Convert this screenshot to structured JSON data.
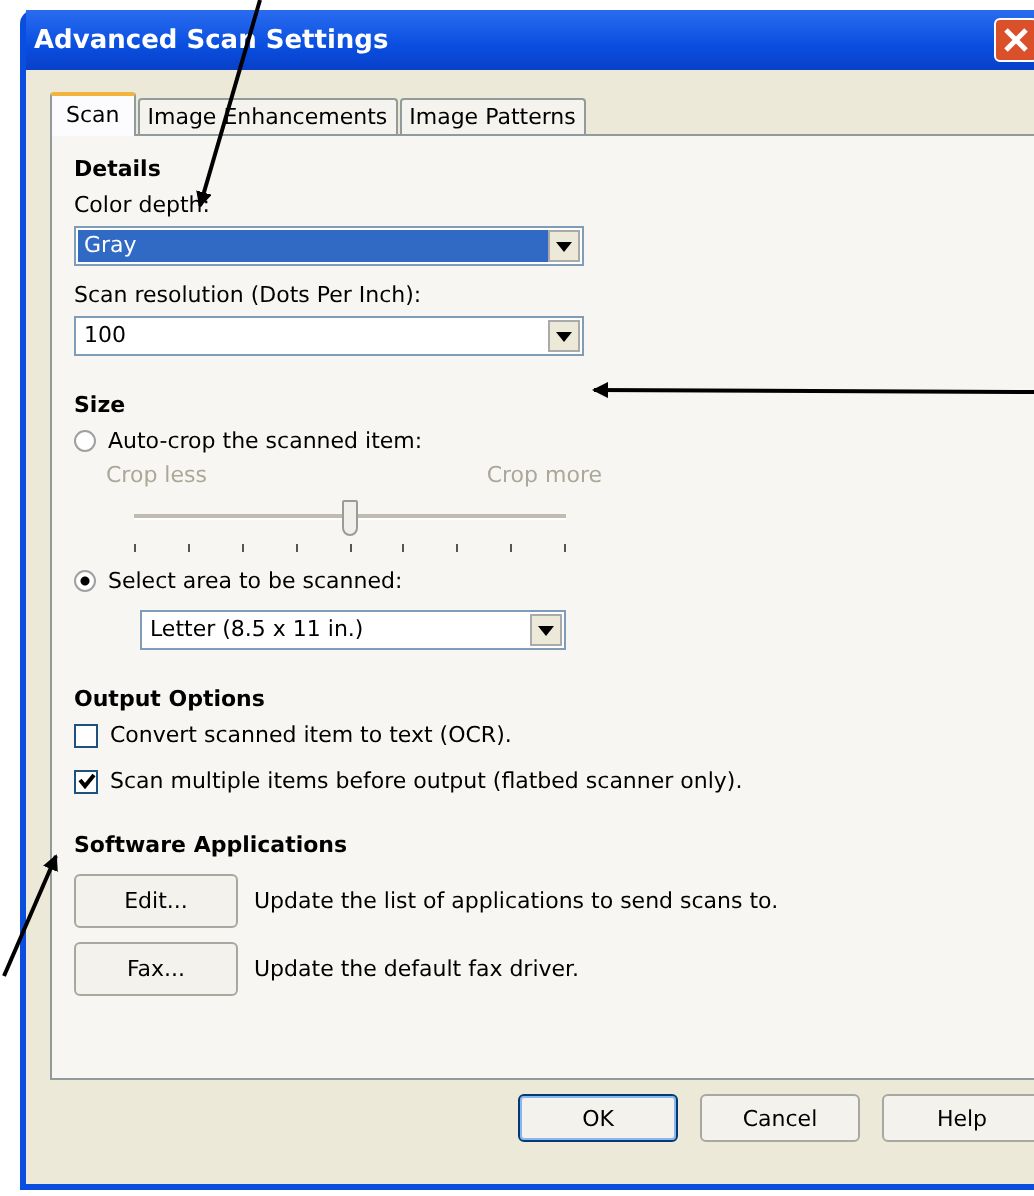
{
  "window": {
    "title": "Advanced Scan Settings"
  },
  "tabs": [
    {
      "label": "Scan",
      "selected": true
    },
    {
      "label": "Image Enhancements",
      "selected": false
    },
    {
      "label": "Image Patterns",
      "selected": false
    }
  ],
  "details": {
    "heading": "Details",
    "color_depth": {
      "label": "Color depth:",
      "value": "Gray",
      "focused": true
    },
    "resolution": {
      "label": "Scan resolution (Dots Per Inch):",
      "value": "100",
      "focused": false
    }
  },
  "size": {
    "heading": "Size",
    "auto_crop": {
      "label": "Auto-crop the scanned item:",
      "selected": false
    },
    "slider": {
      "min_label": "Crop less",
      "max_label": "Crop more",
      "level": 0.5,
      "disabled": true
    },
    "select_area": {
      "label": "Select area to be scanned:",
      "selected": true
    },
    "area": {
      "value": "Letter (8.5 x 11 in.)"
    }
  },
  "output": {
    "heading": "Output Options",
    "options": [
      {
        "label": "Convert scanned item to text (OCR).",
        "checked": false
      },
      {
        "label": "Scan multiple items before output (flatbed scanner only).",
        "checked": true
      }
    ]
  },
  "software": {
    "heading": "Software Applications",
    "rows": [
      {
        "button": "Edit...",
        "description": "Update the list of applications to send scans to."
      },
      {
        "button": "Fax...",
        "description": "Update the default fax driver."
      }
    ]
  },
  "buttons": [
    {
      "label": "OK",
      "default": true
    },
    {
      "label": "Cancel",
      "default": false
    },
    {
      "label": "Help",
      "default": false
    }
  ]
}
